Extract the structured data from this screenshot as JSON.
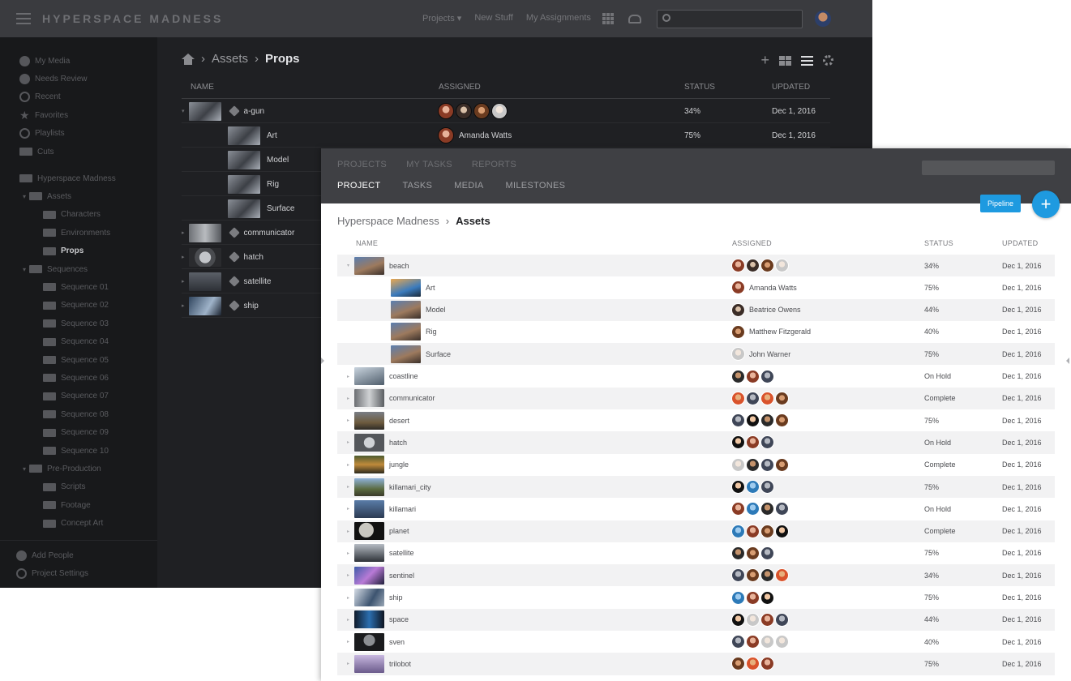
{
  "dark": {
    "app_title": "HYPERSPACE MADNESS",
    "nav": [
      "Projects ▾",
      "New Stuff",
      "My Assignments"
    ],
    "sidebar": {
      "top_items": [
        {
          "label": "My Media",
          "icon": "dot-icon"
        },
        {
          "label": "Needs Review",
          "icon": "dot-icon"
        },
        {
          "label": "Recent",
          "icon": "clock-icon"
        },
        {
          "label": "Favorites",
          "icon": "star-icon"
        },
        {
          "label": "Playlists",
          "icon": "play-icon"
        },
        {
          "label": "Cuts",
          "icon": "cuts-icon"
        }
      ],
      "tree": [
        {
          "label": "Hyperspace Madness",
          "level": 0,
          "active": false
        },
        {
          "label": "Assets",
          "level": 1,
          "active": false
        },
        {
          "label": "Characters",
          "level": 2,
          "active": false
        },
        {
          "label": "Environments",
          "level": 2,
          "active": false
        },
        {
          "label": "Props",
          "level": 2,
          "active": true
        },
        {
          "label": "Sequences",
          "level": 1,
          "active": false
        },
        {
          "label": "Sequence 01",
          "level": 2,
          "active": false
        },
        {
          "label": "Sequence 02",
          "level": 2,
          "active": false
        },
        {
          "label": "Sequence 03",
          "level": 2,
          "active": false
        },
        {
          "label": "Sequence 04",
          "level": 2,
          "active": false
        },
        {
          "label": "Sequence 05",
          "level": 2,
          "active": false
        },
        {
          "label": "Sequence 06",
          "level": 2,
          "active": false
        },
        {
          "label": "Sequence 07",
          "level": 2,
          "active": false
        },
        {
          "label": "Sequence 08",
          "level": 2,
          "active": false
        },
        {
          "label": "Sequence 09",
          "level": 2,
          "active": false
        },
        {
          "label": "Sequence 10",
          "level": 2,
          "active": false
        },
        {
          "label": "Pre-Production",
          "level": 1,
          "active": false
        },
        {
          "label": "Scripts",
          "level": 2,
          "active": false
        },
        {
          "label": "Footage",
          "level": 2,
          "active": false
        },
        {
          "label": "Concept Art",
          "level": 2,
          "active": false
        }
      ],
      "bottom_items": [
        "Add People",
        "Project Settings"
      ]
    },
    "breadcrumb": {
      "parent": "Assets",
      "current": "Props"
    },
    "columns": {
      "name": "NAME",
      "assigned": "ASSIGNED",
      "status": "STATUS",
      "updated": "UPDATED"
    },
    "rows": [
      {
        "name": "a-gun",
        "child": false,
        "expand": "▾",
        "thumb": "t1",
        "avatars": [
          "a1",
          "a2",
          "a3",
          "a4"
        ],
        "assignee": "",
        "status": "34%",
        "updated": "Dec 1, 2016"
      },
      {
        "name": "Art",
        "child": true,
        "expand": "",
        "thumb": "t1",
        "avatars": [
          "a1"
        ],
        "assignee": "Amanda Watts",
        "status": "75%",
        "updated": "Dec 1, 2016"
      },
      {
        "name": "Model",
        "child": true,
        "expand": "",
        "thumb": "t1",
        "avatars": [],
        "assignee": "",
        "status": "",
        "updated": ""
      },
      {
        "name": "Rig",
        "child": true,
        "expand": "",
        "thumb": "t1",
        "avatars": [],
        "assignee": "",
        "status": "",
        "updated": ""
      },
      {
        "name": "Surface",
        "child": true,
        "expand": "",
        "thumb": "t1",
        "avatars": [],
        "assignee": "",
        "status": "",
        "updated": ""
      },
      {
        "name": "communicator",
        "child": false,
        "expand": "▸",
        "thumb": "t2",
        "avatars": [],
        "assignee": "",
        "status": "",
        "updated": ""
      },
      {
        "name": "hatch",
        "child": false,
        "expand": "▸",
        "thumb": "t3",
        "avatars": [],
        "assignee": "",
        "status": "",
        "updated": ""
      },
      {
        "name": "satellite",
        "child": false,
        "expand": "▸",
        "thumb": "t4",
        "avatars": [],
        "assignee": "",
        "status": "",
        "updated": ""
      },
      {
        "name": "ship",
        "child": false,
        "expand": "▸",
        "thumb": "t5",
        "avatars": [],
        "assignee": "",
        "status": "",
        "updated": ""
      }
    ]
  },
  "light": {
    "nav_top": [
      "PROJECTS",
      "MY TASKS",
      "REPORTS"
    ],
    "nav_sub": [
      "PROJECT",
      "TASKS",
      "MEDIA",
      "MILESTONES"
    ],
    "pipeline_label": "Pipeline",
    "add_label": "+",
    "breadcrumb": {
      "parent": "Hyperspace Madness",
      "current": "Assets"
    },
    "columns": {
      "name": "NAME",
      "assigned": "ASSIGNED",
      "status": "STATUS",
      "updated": "UPDATED"
    },
    "rows": [
      {
        "name": "beach",
        "child": false,
        "expand": "▾",
        "thumb": "c1",
        "avatars": [
          "a1",
          "a2",
          "a3",
          "a4"
        ],
        "assignee": "",
        "status": "34%",
        "updated": "Dec 1, 2016"
      },
      {
        "name": "Art",
        "child": true,
        "expand": "",
        "thumb": "c2",
        "avatars": [
          "a1"
        ],
        "assignee": "Amanda Watts",
        "status": "75%",
        "updated": "Dec 1, 2016"
      },
      {
        "name": "Model",
        "child": true,
        "expand": "",
        "thumb": "c1",
        "avatars": [
          "a2"
        ],
        "assignee": "Beatrice Owens",
        "status": "44%",
        "updated": "Dec 1, 2016"
      },
      {
        "name": "Rig",
        "child": true,
        "expand": "",
        "thumb": "c1",
        "avatars": [
          "a3"
        ],
        "assignee": "Matthew Fitzgerald",
        "status": "40%",
        "updated": "Dec 1, 2016"
      },
      {
        "name": "Surface",
        "child": true,
        "expand": "",
        "thumb": "c1",
        "avatars": [
          "a4"
        ],
        "assignee": "John Warner",
        "status": "75%",
        "updated": "Dec 1, 2016"
      },
      {
        "name": "coastline",
        "child": false,
        "expand": "▸",
        "thumb": "c3",
        "avatars": [
          "a5",
          "a1",
          "a9"
        ],
        "assignee": "",
        "status": "On Hold",
        "updated": "Dec 1, 2016"
      },
      {
        "name": "communicator",
        "child": false,
        "expand": "▸",
        "thumb": "c4",
        "avatars": [
          "a8",
          "a9",
          "a8",
          "a3"
        ],
        "assignee": "",
        "status": "Complete",
        "updated": "Dec 1, 2016"
      },
      {
        "name": "desert",
        "child": false,
        "expand": "▸",
        "thumb": "c5",
        "avatars": [
          "a9",
          "a6",
          "a5",
          "a3"
        ],
        "assignee": "",
        "status": "75%",
        "updated": "Dec 1, 2016"
      },
      {
        "name": "hatch",
        "child": false,
        "expand": "▸",
        "thumb": "c6",
        "avatars": [
          "a6",
          "a1",
          "a9"
        ],
        "assignee": "",
        "status": "On Hold",
        "updated": "Dec 1, 2016"
      },
      {
        "name": "jungle",
        "child": false,
        "expand": "▸",
        "thumb": "c7",
        "avatars": [
          "a4",
          "a5",
          "a9",
          "a3"
        ],
        "assignee": "",
        "status": "Complete",
        "updated": "Dec 1, 2016"
      },
      {
        "name": "killamari_city",
        "child": false,
        "expand": "▸",
        "thumb": "c8",
        "avatars": [
          "a6",
          "a7",
          "a9"
        ],
        "assignee": "",
        "status": "75%",
        "updated": "Dec 1, 2016"
      },
      {
        "name": "killamari",
        "child": false,
        "expand": "▸",
        "thumb": "c9",
        "avatars": [
          "a1",
          "a7",
          "a5",
          "a9"
        ],
        "assignee": "",
        "status": "On Hold",
        "updated": "Dec 1, 2016"
      },
      {
        "name": "planet",
        "child": false,
        "expand": "▸",
        "thumb": "c10",
        "avatars": [
          "a7",
          "a1",
          "a3",
          "a6"
        ],
        "assignee": "",
        "status": "Complete",
        "updated": "Dec 1, 2016"
      },
      {
        "name": "satellite",
        "child": false,
        "expand": "▸",
        "thumb": "c11",
        "avatars": [
          "a5",
          "a3",
          "a9"
        ],
        "assignee": "",
        "status": "75%",
        "updated": "Dec 1, 2016"
      },
      {
        "name": "sentinel",
        "child": false,
        "expand": "▸",
        "thumb": "c12",
        "avatars": [
          "a9",
          "a3",
          "a5",
          "a8"
        ],
        "assignee": "",
        "status": "34%",
        "updated": "Dec 1, 2016"
      },
      {
        "name": "ship",
        "child": false,
        "expand": "▸",
        "thumb": "c13",
        "avatars": [
          "a7",
          "a1",
          "a6"
        ],
        "assignee": "",
        "status": "75%",
        "updated": "Dec 1, 2016"
      },
      {
        "name": "space",
        "child": false,
        "expand": "▸",
        "thumb": "c14",
        "avatars": [
          "a6",
          "a4",
          "a1",
          "a9"
        ],
        "assignee": "",
        "status": "44%",
        "updated": "Dec 1, 2016"
      },
      {
        "name": "sven",
        "child": false,
        "expand": "▸",
        "thumb": "c15",
        "avatars": [
          "a9",
          "a1",
          "a4",
          "a4"
        ],
        "assignee": "",
        "status": "40%",
        "updated": "Dec 1, 2016"
      },
      {
        "name": "trilobot",
        "child": false,
        "expand": "▸",
        "thumb": "c16",
        "avatars": [
          "a3",
          "a8",
          "a1"
        ],
        "assignee": "",
        "status": "75%",
        "updated": "Dec 1, 2016"
      }
    ]
  },
  "colors": {
    "accent": "#1e9ae0",
    "dark_bg": "#1f2023",
    "dark_sidebar": "#18191b",
    "light_header": "#3f4044"
  }
}
